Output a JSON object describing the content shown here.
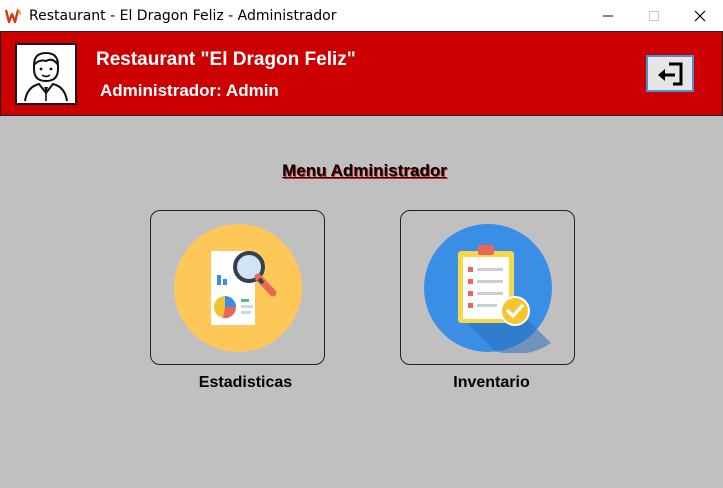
{
  "window": {
    "title": "Restaurant - El Dragon Feliz - Administrador",
    "minimize": "—",
    "maximize": "☐",
    "close": "✕"
  },
  "header": {
    "title": "Restaurant \"El Dragon Feliz\"",
    "subtitle": "Administrador: Admin",
    "accent_color": "#cc0000"
  },
  "main": {
    "menu_title": "Menu Administrador",
    "cards": [
      {
        "label": "Estadisticas",
        "icon": "statistics-report-icon"
      },
      {
        "label": "Inventario",
        "icon": "inventory-checklist-icon"
      }
    ]
  }
}
